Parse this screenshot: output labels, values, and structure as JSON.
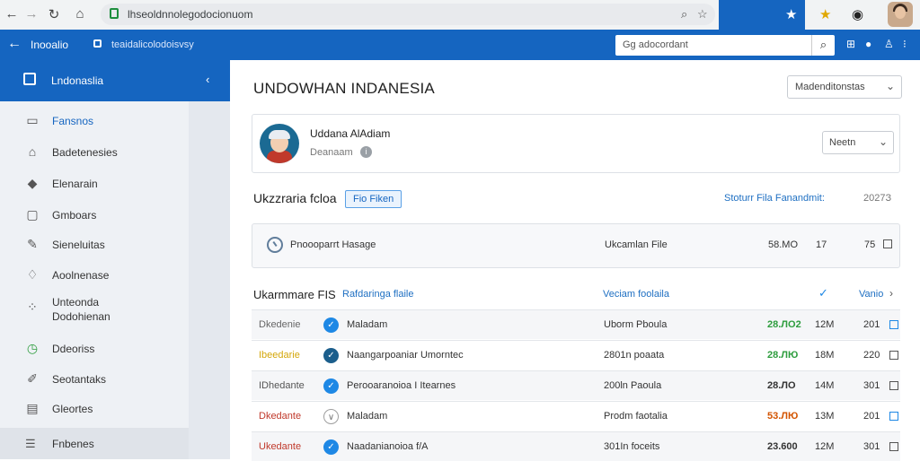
{
  "browser": {
    "url": "lhseoldnnolegodocionuom",
    "nav_icons": [
      "back-arrow-icon",
      "forward-arrow-icon",
      "reload-icon",
      "home-icon"
    ]
  },
  "appbar": {
    "title": "Inooalio",
    "breadcrumb": "teaidalicolodoisvsy",
    "search_placeholder": "Gg adocordant"
  },
  "sidebar": {
    "header_label": "Lndonaslia",
    "items": [
      {
        "label": "Fansnos",
        "icon": "calendar-icon",
        "active": true
      },
      {
        "label": "Badetenesies",
        "icon": "home-icon"
      },
      {
        "label": "Elenarain",
        "icon": "tag-icon"
      },
      {
        "label": "Gmboars",
        "icon": "chat-icon"
      },
      {
        "label": "Sieneluitas",
        "icon": "pencil-icon"
      },
      {
        "label": "Aoolnenase",
        "icon": "flame-icon"
      },
      {
        "label": "Unteonda Dodohienan",
        "icon": "grid-dots-icon"
      },
      {
        "label": "Ddeoriss",
        "icon": "clock-icon"
      },
      {
        "label": "Seotantaks",
        "icon": "edit-icon"
      },
      {
        "label": "Gleortes",
        "icon": "document-icon"
      }
    ],
    "footer_label": "Fnbenes"
  },
  "main": {
    "title": "UNDOWHAN INDANESIA",
    "top_select": "Madenditonstas",
    "profile": {
      "name": "Uddana AlAdiam",
      "role": "Deanaam",
      "select_value": "Neetn"
    },
    "section1": {
      "title": "Ukzzraria fcloa",
      "chip": "Fio Fiken",
      "right_label": "Stoturr Fila Fanandmit:",
      "right_num": "2027З"
    },
    "highlight_file": {
      "name": "Pnoooparrt Hasage",
      "type": "Ukcamlan File",
      "c1": "58.МО",
      "c2": "17",
      "c3": "75"
    },
    "section2": {
      "title": "Ukarmmare FIS",
      "link": "Rafdaringa flaile",
      "mid": "Veciam foolaila",
      "right": "Vanio"
    },
    "rows": [
      {
        "status": "Dkedenie",
        "status_color": "#666666",
        "name": "Maladam",
        "type": "Uborm Pboula",
        "value": "28.ЛО2",
        "value_color": "#2e9d3e",
        "size": "12M",
        "num": "201",
        "icon_color": "#1e88e5",
        "box_blue": true
      },
      {
        "status": "Ibeedarie",
        "status_color": "#d4a70a",
        "name": "Naangarpoaniar Umorntec",
        "type": "2801n poaata",
        "value": "28.ЛЮ",
        "value_color": "#2e9d3e",
        "size": "18M",
        "num": "220",
        "icon_color": "#1b5e8c",
        "box_blue": false
      },
      {
        "status": "IDhedante",
        "status_color": "#555555",
        "name": "Perooaranoioa I Itearnes",
        "type": "200ln Paoula",
        "value": "28.ЛО",
        "value_color": "#333333",
        "size": "14M",
        "num": "301",
        "icon_color": "#1e88e5",
        "box_blue": false
      },
      {
        "status": "Dkedante",
        "status_color": "#c0392b",
        "name": "Maladam",
        "type": "Prodm faotalia",
        "value": "53.ЛЮ",
        "value_color": "#d35400",
        "size": "13M",
        "num": "201",
        "icon_color": "#9e9e9e",
        "box_blue": true
      },
      {
        "status": "Ukedante",
        "status_color": "#c0392b",
        "name": "Naadanianoioa f/A",
        "type": "301In foceits",
        "value": "23.600",
        "value_color": "#333333",
        "size": "12M",
        "num": "301",
        "icon_color": "#1e88e5",
        "box_blue": false
      }
    ]
  },
  "colors": {
    "brand": "#1565c0",
    "sidebar_bg": "#eef1f5",
    "link": "#1e6fc2"
  }
}
